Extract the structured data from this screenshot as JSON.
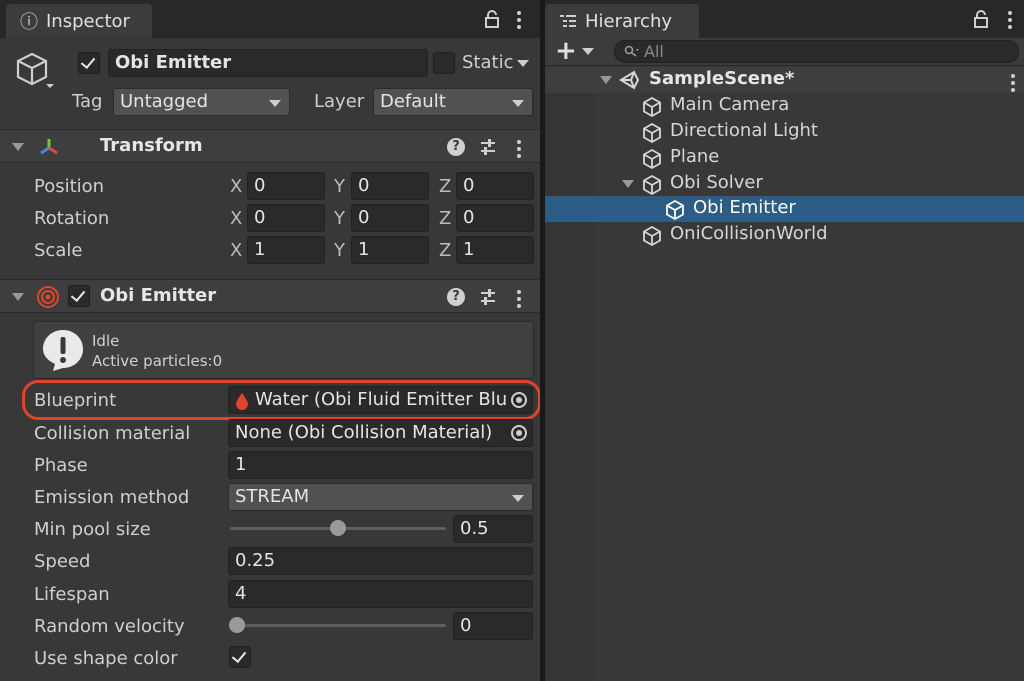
{
  "inspector": {
    "tab_label": "Inspector",
    "object": {
      "name": "Obi Emitter",
      "active": true,
      "static_label": "Static",
      "static_checked": false,
      "tag_label": "Tag",
      "tag_value": "Untagged",
      "layer_label": "Layer",
      "layer_value": "Default"
    },
    "transform": {
      "title": "Transform",
      "rows": [
        {
          "label": "Position",
          "x": "0",
          "y": "0",
          "z": "0"
        },
        {
          "label": "Rotation",
          "x": "0",
          "y": "0",
          "z": "0"
        },
        {
          "label": "Scale",
          "x": "1",
          "y": "1",
          "z": "1"
        }
      ],
      "axis_x": "X",
      "axis_y": "Y",
      "axis_z": "Z"
    },
    "emitter": {
      "title": "Obi Emitter",
      "enabled": true,
      "status_line1": "Idle",
      "status_line2": "Active particles:0",
      "blueprint_label": "Blueprint",
      "blueprint_value": "Water (Obi Fluid Emitter Blue",
      "collision_label": "Collision material",
      "collision_value": "None (Obi Collision Material)",
      "phase_label": "Phase",
      "phase_value": "1",
      "emission_label": "Emission method",
      "emission_value": "STREAM",
      "minpool_label": "Min pool size",
      "minpool_value": "0.5",
      "speed_label": "Speed",
      "speed_value": "0.25",
      "lifespan_label": "Lifespan",
      "lifespan_value": "4",
      "randvel_label": "Random velocity",
      "randvel_value": "0",
      "shapecolor_label": "Use shape color",
      "shapecolor_checked": true
    }
  },
  "hierarchy": {
    "tab_label": "Hierarchy",
    "add_label": "+",
    "search_placeholder": "All",
    "scene_name": "SampleScene*",
    "items": [
      {
        "label": "Main Camera"
      },
      {
        "label": "Directional Light"
      },
      {
        "label": "Plane"
      },
      {
        "label": "Obi Solver"
      },
      {
        "label": "Obi Emitter"
      },
      {
        "label": "OniCollisionWorld"
      }
    ]
  },
  "colors": {
    "highlight_outline": "#e0442a",
    "selection": "#2c5d87",
    "panel_bg": "#383838"
  }
}
